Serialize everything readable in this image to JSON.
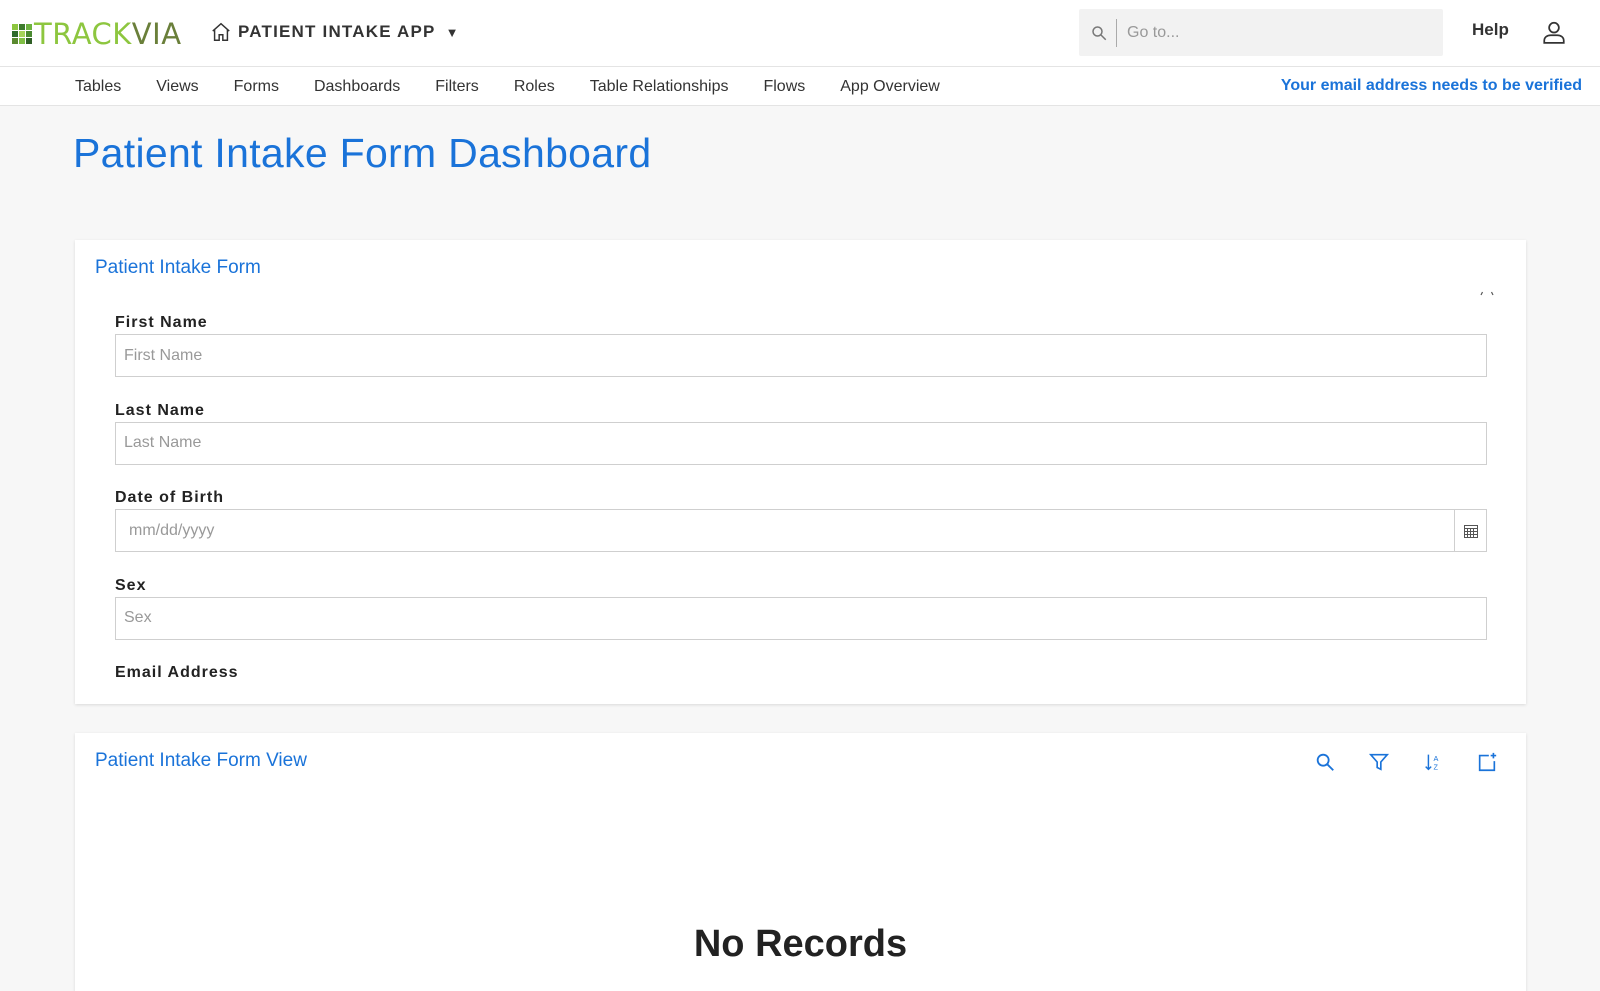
{
  "header": {
    "logo": {
      "part1": "TRACK",
      "part2": "VIA",
      "colors": [
        "#8dc63f",
        "#5a8a2f",
        "#2e6b2a",
        "#6db33f",
        "#3d7b2c",
        "#a5d35a",
        "#2f5f25",
        "#7fbf44",
        "#4a8a30"
      ]
    },
    "app_name": "PATIENT INTAKE APP",
    "search": {
      "placeholder": "Go to..."
    },
    "help_label": "Help",
    "icons": {
      "home": "home-icon",
      "search": "search-icon",
      "user": "user-icon",
      "caret": "caret-down-icon"
    }
  },
  "nav": {
    "items": [
      {
        "label": "Tables"
      },
      {
        "label": "Views"
      },
      {
        "label": "Forms"
      },
      {
        "label": "Dashboards"
      },
      {
        "label": "Filters"
      },
      {
        "label": "Roles"
      },
      {
        "label": "Table Relationships"
      },
      {
        "label": "Flows"
      },
      {
        "label": "App Overview"
      }
    ],
    "verify_notice": "Your email address needs to be verified"
  },
  "page": {
    "title": "Patient Intake Form Dashboard",
    "accent_color": "#1a73d9"
  },
  "form_panel": {
    "title": "Patient Intake Form",
    "fields": [
      {
        "label": "First Name",
        "placeholder": "First Name"
      },
      {
        "label": "Last Name",
        "placeholder": "Last Name"
      },
      {
        "label": "Date of Birth",
        "placeholder": "mm/dd/yyyy"
      },
      {
        "label": "Sex",
        "placeholder": "Sex"
      },
      {
        "label": "Email Address",
        "placeholder": ""
      }
    ]
  },
  "view_panel": {
    "title": "Patient Intake Form View",
    "tools": [
      "search-icon",
      "filter-icon",
      "sort-icon",
      "add-record-icon"
    ],
    "empty_message": "No Records"
  }
}
